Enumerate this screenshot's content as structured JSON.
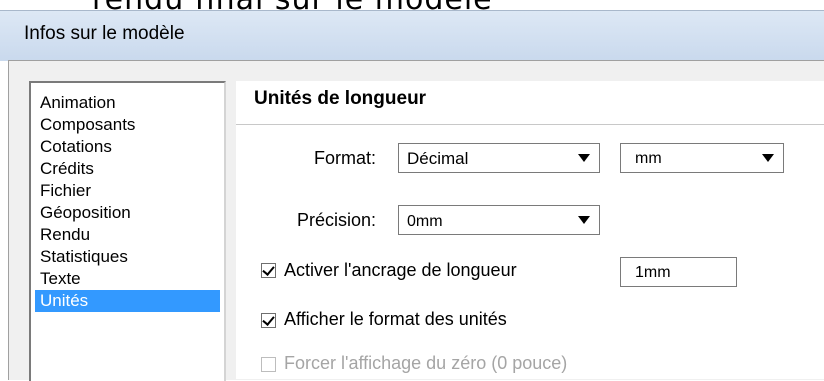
{
  "window": {
    "title": "Infos sur le modèle"
  },
  "sidebar": {
    "items": [
      {
        "label": "Animation",
        "selected": false
      },
      {
        "label": "Composants",
        "selected": false
      },
      {
        "label": "Cotations",
        "selected": false
      },
      {
        "label": "Crédits",
        "selected": false
      },
      {
        "label": "Fichier",
        "selected": false
      },
      {
        "label": "Géoposition",
        "selected": false
      },
      {
        "label": "Rendu",
        "selected": false
      },
      {
        "label": "Statistiques",
        "selected": false
      },
      {
        "label": "Texte",
        "selected": false
      },
      {
        "label": "Unités",
        "selected": true
      }
    ]
  },
  "length_units": {
    "heading": "Unités de longueur",
    "format_label": "Format:",
    "format_value": "Décimal",
    "unit_value": "mm",
    "precision_label": "Précision:",
    "precision_value": "0mm",
    "snap_label": "Activer l'ancrage de longueur",
    "snap_checked": true,
    "snap_value": "1mm",
    "show_format_label": "Afficher le format des unités",
    "show_format_checked": true,
    "force_zero_label": "Forcer l'affichage du zéro (0 pouce)",
    "force_zero_checked": false,
    "force_zero_enabled": false
  },
  "colors": {
    "selection": "#3399ff",
    "titlebar": "#c9d9ed"
  }
}
